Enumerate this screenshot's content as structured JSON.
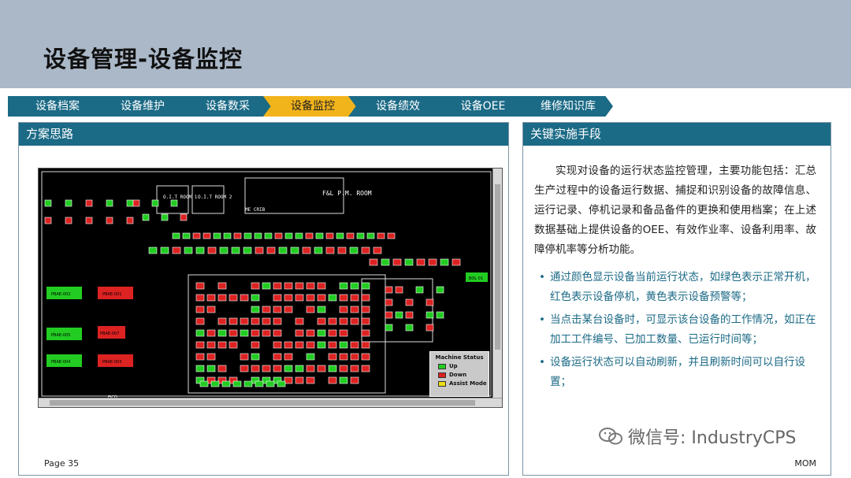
{
  "slide": {
    "title": "设备管理-设备监控",
    "page_label": "Page 35",
    "footer_right": "MOM"
  },
  "nav": [
    {
      "label": "设备档案",
      "active": false
    },
    {
      "label": "设备维护",
      "active": false
    },
    {
      "label": "设备数采",
      "active": false
    },
    {
      "label": "设备监控",
      "active": true
    },
    {
      "label": "设备绩效",
      "active": false
    },
    {
      "label": "设备OEE",
      "active": false
    },
    {
      "label": "维修知识库",
      "active": false
    }
  ],
  "left_panel": {
    "title": "方案思路",
    "floorplan": {
      "room_labels": [
        "O.I.T ROOM 1",
        "O.I.T ROOM 2",
        "F&L P.M. ROOM",
        "ME CRIB"
      ],
      "machine_tags": [
        "PBAE-002",
        "PBAE-001",
        "PBAE-005",
        "PBAE-007",
        "PBAE-004",
        "PBAE-003",
        "BOL 01",
        "FICO"
      ],
      "legend": {
        "title": "Machine Status",
        "items": [
          {
            "label": "Up",
            "color": "#22cc22"
          },
          {
            "label": "Down",
            "color": "#dd2222"
          },
          {
            "label": "Assist Mode",
            "color": "#eedd11"
          }
        ]
      }
    }
  },
  "right_panel": {
    "title": "关键实施手段",
    "intro": "实现对设备的运行状态监控管理，主要功能包括：汇总生产过程中的设备运行数据、捕捉和识别设备的故障信息、运行记录、停机记录和备品备件的更换和使用档案；在上述数据基础上提供设备的OEE、有效作业率、设备利用率、故障停机率等分析功能。",
    "bullets": [
      "通过颜色显示设备当前运行状态，如绿色表示正常开机，红色表示设备停机，黄色表示设备预警等；",
      "当点击某台设备时，可显示该台设备的工作情况，如正在加工工件编号、已加工数量、已运行时间等；",
      "设备运行状态可以自动刷新，并且刷新时间可以自行设置；"
    ],
    "watermark": "微信号: IndustryCPS"
  },
  "colors": {
    "header_bg": "#aab8c8",
    "nav_bg": "#1b6a86",
    "nav_active": "#f2b41b",
    "status_up": "#22cc22",
    "status_down": "#dd2222"
  }
}
